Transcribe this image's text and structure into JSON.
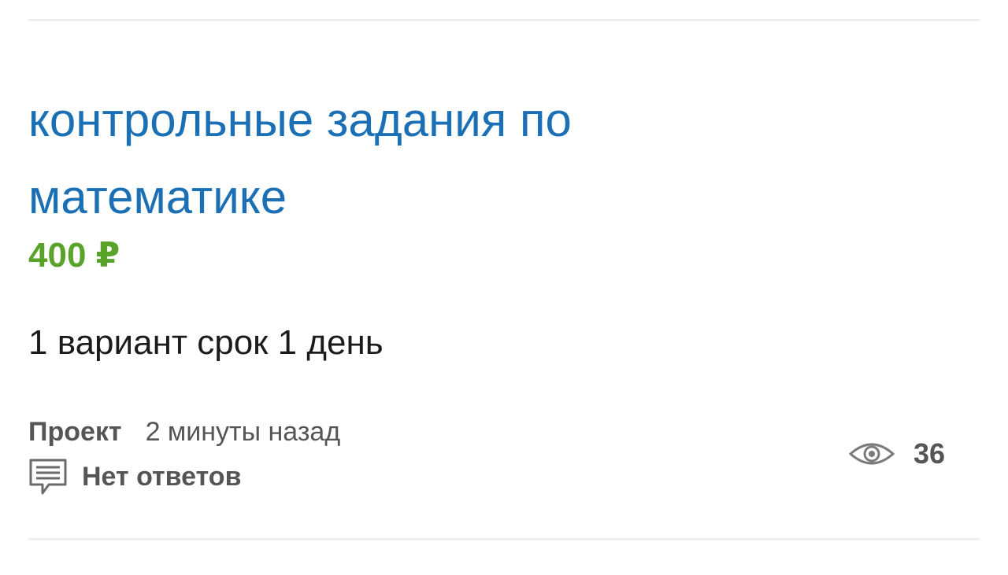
{
  "project": {
    "title": "контрольные задания по математике",
    "price": "400 ₽",
    "description": "1 вариант срок 1 день",
    "type_label": "Проект",
    "posted_time": "2 минуты назад",
    "answers_label": "Нет ответов",
    "views_count": "36",
    "icons": {
      "answers": "comment-icon",
      "views": "eye-icon"
    }
  },
  "colors": {
    "title": "#1a6fb5",
    "price": "#5aa32b",
    "meta": "#555555",
    "divider": "#eeeeee"
  }
}
